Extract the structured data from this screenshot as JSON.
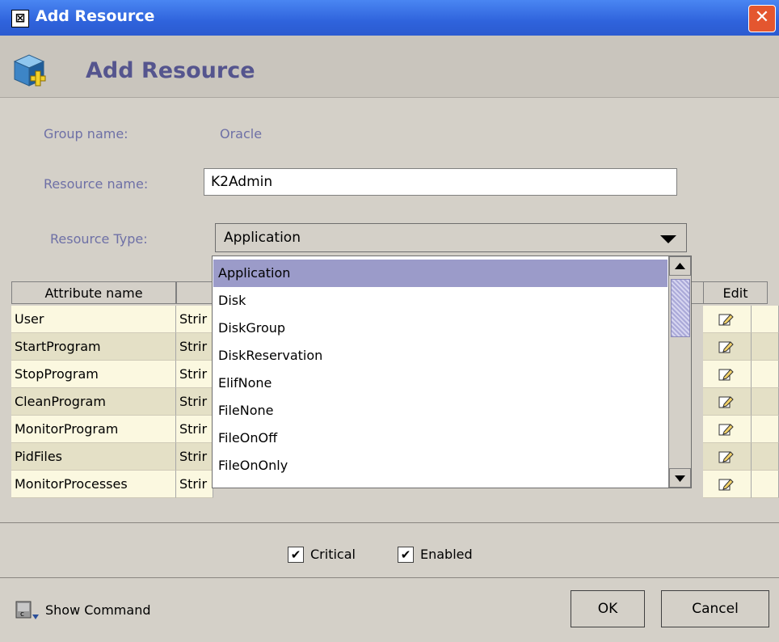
{
  "window": {
    "title": "Add Resource",
    "close_symbol": "✕",
    "title_icon_symbol": "⊠"
  },
  "header": {
    "title": "Add Resource"
  },
  "form": {
    "group_label": "Group name:",
    "group_value": "Oracle",
    "resource_name_label": "Resource name:",
    "resource_name_value": "K2Admin",
    "resource_type_label": "Resource Type:",
    "resource_type_value": "Application"
  },
  "table": {
    "columns": [
      "Attribute name",
      "Edit"
    ],
    "rows": [
      {
        "name": "User",
        "type": "Strir"
      },
      {
        "name": "StartProgram",
        "type": "Strir"
      },
      {
        "name": "StopProgram",
        "type": "Strir"
      },
      {
        "name": "CleanProgram",
        "type": "Strir"
      },
      {
        "name": "MonitorProgram",
        "type": "Strir"
      },
      {
        "name": "PidFiles",
        "type": "Strir"
      },
      {
        "name": "MonitorProcesses",
        "type": "Strir"
      }
    ]
  },
  "dropdown": {
    "options": [
      "Application",
      "Disk",
      "DiskGroup",
      "DiskReservation",
      "ElifNone",
      "FileNone",
      "FileOnOff",
      "FileOnOnly"
    ],
    "selected_index": 0
  },
  "checks": {
    "critical_label": "Critical",
    "critical_checked": true,
    "enabled_label": "Enabled",
    "enabled_checked": true,
    "check_mark": "✔"
  },
  "footer": {
    "show_command_label": "Show Command",
    "ok_label": "OK",
    "cancel_label": "Cancel"
  },
  "icons": [
    "window-icon",
    "close-icon",
    "add-resource-cube-icon",
    "edit-pencil-icon",
    "command-icon",
    "scroll-up-icon",
    "scroll-down-icon"
  ]
}
